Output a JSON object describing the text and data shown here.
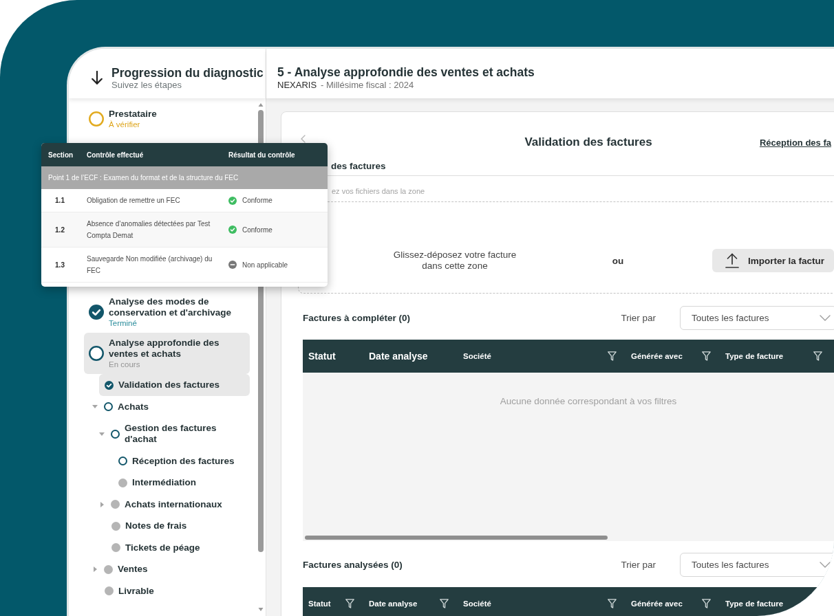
{
  "sidebar": {
    "title": "Progression du diagnostic",
    "subtitle": "Suivez les étapes",
    "steps": [
      {
        "title": "Prestataire",
        "subtitle": "À vérifier",
        "kind": "warning",
        "selected": false
      },
      {
        "title": "Analyse des modes de conservation et d'archivage",
        "subtitle": "Terminé",
        "kind": "done",
        "selected": false
      },
      {
        "title": "Analyse approfondie des ventes et achats",
        "subtitle": "En cours",
        "kind": "current",
        "selected": true,
        "children": [
          {
            "label": "Validation des factures",
            "kind": "done",
            "selected": true
          },
          {
            "label": "Achats",
            "kind": "current",
            "selected": false,
            "expanded": true,
            "children": [
              {
                "label": "Gestion des factures d'achat",
                "kind": "current",
                "selected": false,
                "expanded": true,
                "children": [
                  {
                    "label": "Réception des factures",
                    "kind": "current",
                    "selected": false
                  },
                  {
                    "label": "Intermédiation",
                    "kind": "pending",
                    "selected": false
                  }
                ]
              },
              {
                "label": "Achats internationaux",
                "kind": "pending",
                "selected": false,
                "expanded": false
              },
              {
                "label": "Notes de frais",
                "kind": "pending",
                "selected": false
              },
              {
                "label": "Tickets de péage",
                "kind": "pending",
                "selected": false
              }
            ]
          },
          {
            "label": "Ventes",
            "kind": "pending",
            "selected": false,
            "expanded": false
          },
          {
            "label": "Livrable",
            "kind": "pending",
            "selected": false
          }
        ]
      }
    ]
  },
  "header": {
    "title": "5 - Analyse approfondie des ventes et achats",
    "company": "NEXARIS",
    "fiscal_year": "- Millésime fiscal : 2024"
  },
  "card": {
    "title": "Validation des factures",
    "next_link": "Réception des fa",
    "upload": {
      "section_title": "des factures",
      "hint": "ez vos fichiers dans la zone",
      "drop_text": "Glissez-déposez votre facture dans cette zone",
      "separator": "ou",
      "button": "Importer la factur"
    },
    "tables": [
      {
        "title": "Factures à compléter (0)",
        "sort_label": "Trier par",
        "sort_value": "Toutes les factures",
        "columns": [
          {
            "label": "Statut",
            "filter": false,
            "large": true
          },
          {
            "label": "Date analyse",
            "filter": false,
            "large": true
          },
          {
            "label": "Société",
            "filter": true,
            "large": false
          },
          {
            "label": "Générée avec",
            "filter": true,
            "large": false
          },
          {
            "label": "Type de facture",
            "filter": true,
            "large": false
          }
        ],
        "empty_message": "Aucune donnée correspondant à vos filtres"
      },
      {
        "title": "Factures analysées (0)",
        "sort_label": "Trier par",
        "sort_value": "Toutes les factures",
        "columns": [
          {
            "label": "Statut",
            "filter": true,
            "large": false
          },
          {
            "label": "Date analyse",
            "filter": true,
            "large": false
          },
          {
            "label": "Société",
            "filter": true,
            "large": false
          },
          {
            "label": "Générée avec",
            "filter": true,
            "large": false
          },
          {
            "label": "Type de facture",
            "filter": false,
            "large": false
          }
        ]
      }
    ]
  },
  "popup": {
    "columns": [
      "Section",
      "Contrôle effectué",
      "Résultat du contrôle"
    ],
    "group": "Point 1 de l’ECF : Examen du format et de la structure du FEC",
    "rows": [
      {
        "section": "1.1",
        "control": "Obligation de remettre un FEC",
        "result": "Conforme",
        "kind": "ok"
      },
      {
        "section": "1.2",
        "control": "Absence d’anomalies détectées par Test Compta Demat",
        "result": "Conforme",
        "kind": "ok"
      },
      {
        "section": "1.3",
        "control": "Sauvegarde Non modifiée (archivage) du FEC",
        "result": "Non applicable",
        "kind": "na"
      }
    ]
  }
}
